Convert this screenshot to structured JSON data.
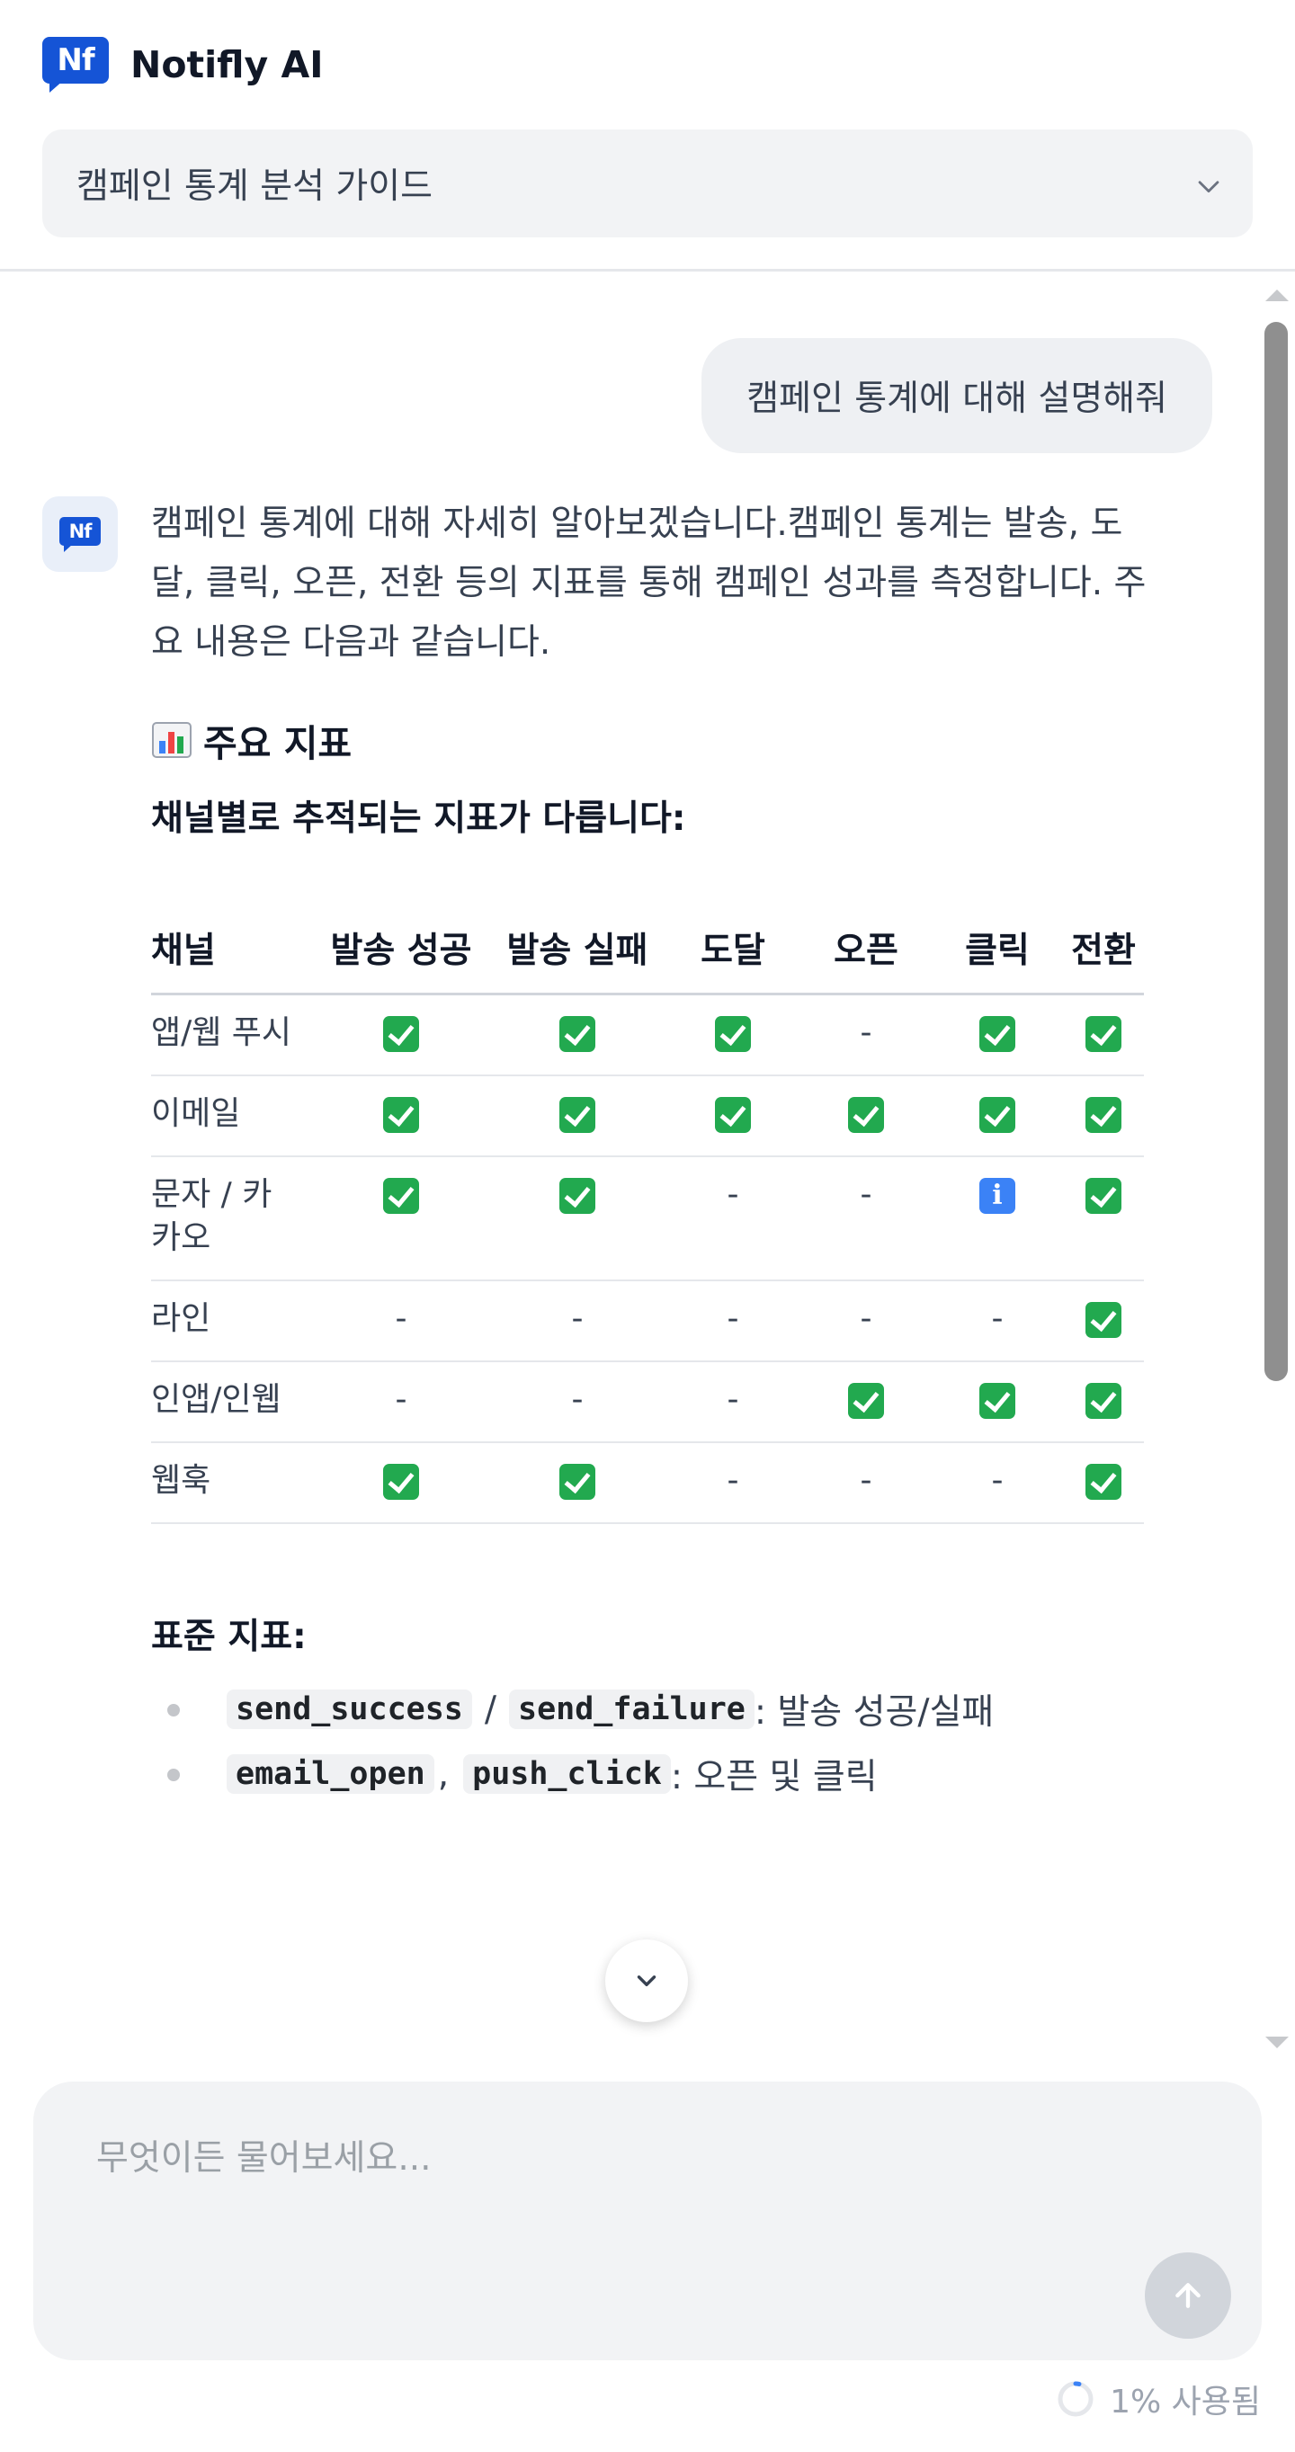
{
  "app": {
    "logo_text": "Nf",
    "name": "Notifly AI"
  },
  "topic_select": {
    "value": "캠페인 통계 분석 가이드"
  },
  "conversation": {
    "user_message": "캠페인 통계에 대해 설명해줘",
    "assistant": {
      "avatar_text": "Nf",
      "intro": "캠페인 통계에 대해 자세히 알아보겠습니다.캠페인 통계는 발송, 도달, 클릭, 오픈, 전환 등의 지표를 통해 캠페인 성과를 측정합니다. 주요 내용은 다음과 같습니다.",
      "section_title": "주요 지표",
      "section_icon": "bar-chart-icon",
      "subtitle": "채널별로 추적되는 지표가 다릅니다:",
      "table": {
        "headers": [
          "채널",
          "발송 성공",
          "발송 실패",
          "도달",
          "오픈",
          "클릭",
          "전환"
        ],
        "rows": [
          {
            "channel": "앱/웹 푸시",
            "cells": [
              "check",
              "check",
              "check",
              "-",
              "check",
              "check"
            ]
          },
          {
            "channel": "이메일",
            "cells": [
              "check",
              "check",
              "check",
              "check",
              "check",
              "check"
            ]
          },
          {
            "channel": "문자 / 카카오",
            "cells": [
              "check",
              "check",
              "-",
              "-",
              "info",
              "check"
            ]
          },
          {
            "channel": "라인",
            "cells": [
              "-",
              "-",
              "-",
              "-",
              "-",
              "check"
            ]
          },
          {
            "channel": "인앱/인웹",
            "cells": [
              "-",
              "-",
              "-",
              "check",
              "check",
              "check"
            ]
          },
          {
            "channel": "웹훅",
            "cells": [
              "check",
              "check",
              "-",
              "-",
              "-",
              "check"
            ]
          }
        ]
      },
      "standard_title": "표준 지표:",
      "standard_items": [
        {
          "codes": [
            "send_success",
            "send_failure"
          ],
          "joiner": "/",
          "desc": ": 발송 성공/실패"
        },
        {
          "codes": [
            "email_open",
            "push_click"
          ],
          "joiner": ",",
          "desc": ": 오픈 및 클릭"
        }
      ]
    }
  },
  "composer": {
    "placeholder": "무엇이든 물어보세요..."
  },
  "usage": {
    "text": "1% 사용됨",
    "percent": 1
  },
  "colors": {
    "brand": "#1554d6",
    "check": "#22a94f",
    "info": "#3b82f6"
  }
}
